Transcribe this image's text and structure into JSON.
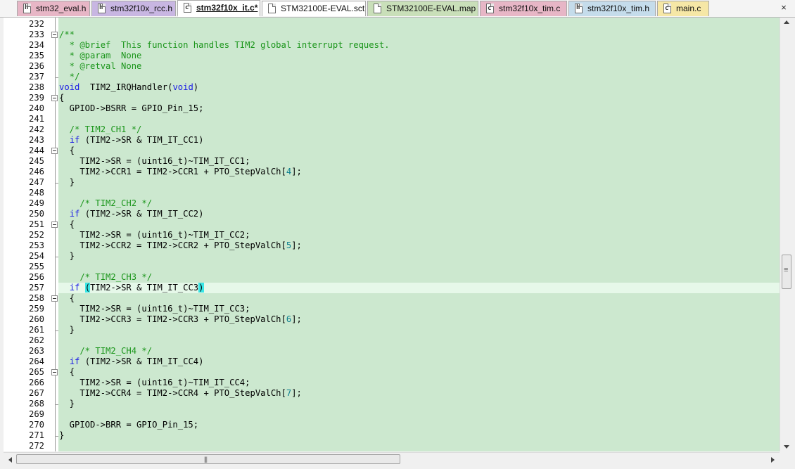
{
  "tabs": [
    {
      "label": "stm32_eval.h",
      "icon": "header-file-icon",
      "color": "#e7b6c6",
      "active": false
    },
    {
      "label": "stm32f10x_rcc.h",
      "icon": "header-file-icon",
      "color": "#c8b6e2",
      "active": false
    },
    {
      "label": "stm32f10x_it.c*",
      "icon": "source-file-icon",
      "color": "#ffffff",
      "active": true
    },
    {
      "label": "STM32100E-EVAL.sct",
      "icon": "file-icon",
      "color": "#ffffff",
      "active": false
    },
    {
      "label": "STM32100E-EVAL.map",
      "icon": "file-icon",
      "color": "#c9dfb9",
      "active": false
    },
    {
      "label": "stm32f10x_tim.c",
      "icon": "source-file-icon",
      "color": "#e7b6c6",
      "active": false
    },
    {
      "label": "stm32f10x_tim.h",
      "icon": "header-file-icon",
      "color": "#c5dceb",
      "active": false
    },
    {
      "label": "main.c",
      "icon": "source-file-icon",
      "color": "#f6e7a6",
      "active": false
    }
  ],
  "tabs_close": "×",
  "colors": {
    "editor_background": "#cce8cf",
    "current_line": "#e6f8e9",
    "keyword": "#1a1ae6",
    "comment": "#1a951a",
    "number": "#0b7f8f",
    "brace_match": "#39e6e6"
  },
  "editor": {
    "lines": [
      {
        "n": "232",
        "fold": "none",
        "parts": [
          {
            "t": "",
            "c": ""
          }
        ]
      },
      {
        "n": "233",
        "fold": "open",
        "parts": [
          {
            "t": "/**",
            "c": "cm"
          }
        ]
      },
      {
        "n": "234",
        "fold": "none",
        "parts": [
          {
            "t": "  * @brief  This function handles TIM2 global interrupt request.",
            "c": "cm"
          }
        ]
      },
      {
        "n": "235",
        "fold": "none",
        "parts": [
          {
            "t": "  * @param  None",
            "c": "cm"
          }
        ]
      },
      {
        "n": "236",
        "fold": "none",
        "parts": [
          {
            "t": "  * @retval None",
            "c": "cm"
          }
        ]
      },
      {
        "n": "237",
        "fold": "end",
        "parts": [
          {
            "t": "  */",
            "c": "cm"
          }
        ]
      },
      {
        "n": "238",
        "fold": "none",
        "parts": [
          {
            "t": "void",
            "c": "kw"
          },
          {
            "t": "  TIM2_IRQHandler(",
            "c": ""
          },
          {
            "t": "void",
            "c": "kw"
          },
          {
            "t": ")",
            "c": ""
          }
        ]
      },
      {
        "n": "239",
        "fold": "open",
        "parts": [
          {
            "t": "{",
            "c": ""
          }
        ]
      },
      {
        "n": "240",
        "fold": "none",
        "parts": [
          {
            "t": "  GPIOD->BSRR = GPIO_Pin_15;",
            "c": ""
          }
        ]
      },
      {
        "n": "241",
        "fold": "none",
        "parts": [
          {
            "t": "",
            "c": ""
          }
        ]
      },
      {
        "n": "242",
        "fold": "none",
        "parts": [
          {
            "t": "  /* TIM2_CH1 */",
            "c": "cm"
          }
        ]
      },
      {
        "n": "243",
        "fold": "none",
        "parts": [
          {
            "t": "  ",
            "c": ""
          },
          {
            "t": "if",
            "c": "kw"
          },
          {
            "t": " (TIM2->SR & TIM_IT_CC1)",
            "c": ""
          }
        ]
      },
      {
        "n": "244",
        "fold": "open",
        "parts": [
          {
            "t": "  {",
            "c": ""
          }
        ]
      },
      {
        "n": "245",
        "fold": "none",
        "parts": [
          {
            "t": "    TIM2->SR = (uint16_t)~TIM_IT_CC1;",
            "c": ""
          }
        ]
      },
      {
        "n": "246",
        "fold": "none",
        "parts": [
          {
            "t": "    TIM2->CCR1 = TIM2->CCR1 + PTO_StepValCh[",
            "c": ""
          },
          {
            "t": "4",
            "c": "num"
          },
          {
            "t": "];",
            "c": ""
          }
        ]
      },
      {
        "n": "247",
        "fold": "end",
        "parts": [
          {
            "t": "  }",
            "c": ""
          }
        ]
      },
      {
        "n": "248",
        "fold": "none",
        "parts": [
          {
            "t": "",
            "c": ""
          }
        ]
      },
      {
        "n": "249",
        "fold": "none",
        "parts": [
          {
            "t": "    /* TIM2_CH2 */",
            "c": "cm"
          }
        ]
      },
      {
        "n": "250",
        "fold": "none",
        "parts": [
          {
            "t": "  ",
            "c": ""
          },
          {
            "t": "if",
            "c": "kw"
          },
          {
            "t": " (TIM2->SR & TIM_IT_CC2)",
            "c": ""
          }
        ]
      },
      {
        "n": "251",
        "fold": "open",
        "parts": [
          {
            "t": "  {",
            "c": ""
          }
        ]
      },
      {
        "n": "252",
        "fold": "none",
        "parts": [
          {
            "t": "    TIM2->SR = (uint16_t)~TIM_IT_CC2;",
            "c": ""
          }
        ]
      },
      {
        "n": "253",
        "fold": "none",
        "parts": [
          {
            "t": "    TIM2->CCR2 = TIM2->CCR2 + PTO_StepValCh[",
            "c": ""
          },
          {
            "t": "5",
            "c": "num"
          },
          {
            "t": "];",
            "c": ""
          }
        ]
      },
      {
        "n": "254",
        "fold": "end",
        "parts": [
          {
            "t": "  }",
            "c": ""
          }
        ]
      },
      {
        "n": "255",
        "fold": "none",
        "parts": [
          {
            "t": "",
            "c": ""
          }
        ]
      },
      {
        "n": "256",
        "fold": "none",
        "parts": [
          {
            "t": "    /* TIM2_CH3 */",
            "c": "cm"
          }
        ]
      },
      {
        "n": "257",
        "fold": "none",
        "current": true,
        "parts": [
          {
            "t": "  ",
            "c": ""
          },
          {
            "t": "if",
            "c": "kw"
          },
          {
            "t": " ",
            "c": ""
          },
          {
            "t": "(",
            "c": "bm"
          },
          {
            "t": "TIM2->SR & TIM_IT_CC3",
            "c": ""
          },
          {
            "t": ")",
            "c": "bm"
          }
        ]
      },
      {
        "n": "258",
        "fold": "open",
        "parts": [
          {
            "t": "  {",
            "c": ""
          }
        ]
      },
      {
        "n": "259",
        "fold": "none",
        "parts": [
          {
            "t": "    TIM2->SR = (uint16_t)~TIM_IT_CC3;",
            "c": ""
          }
        ]
      },
      {
        "n": "260",
        "fold": "none",
        "parts": [
          {
            "t": "    TIM2->CCR3 = TIM2->CCR3 + PTO_StepValCh[",
            "c": ""
          },
          {
            "t": "6",
            "c": "num"
          },
          {
            "t": "];",
            "c": ""
          }
        ]
      },
      {
        "n": "261",
        "fold": "end",
        "parts": [
          {
            "t": "  }",
            "c": ""
          }
        ]
      },
      {
        "n": "262",
        "fold": "none",
        "parts": [
          {
            "t": "",
            "c": ""
          }
        ]
      },
      {
        "n": "263",
        "fold": "none",
        "parts": [
          {
            "t": "    /* TIM2_CH4 */",
            "c": "cm"
          }
        ]
      },
      {
        "n": "264",
        "fold": "none",
        "parts": [
          {
            "t": "  ",
            "c": ""
          },
          {
            "t": "if",
            "c": "kw"
          },
          {
            "t": " (TIM2->SR & TIM_IT_CC4)",
            "c": ""
          }
        ]
      },
      {
        "n": "265",
        "fold": "open",
        "parts": [
          {
            "t": "  {",
            "c": ""
          }
        ]
      },
      {
        "n": "266",
        "fold": "none",
        "parts": [
          {
            "t": "    TIM2->SR = (uint16_t)~TIM_IT_CC4;",
            "c": ""
          }
        ]
      },
      {
        "n": "267",
        "fold": "none",
        "parts": [
          {
            "t": "    TIM2->CCR4 = TIM2->CCR4 + PTO_StepValCh[",
            "c": ""
          },
          {
            "t": "7",
            "c": "num"
          },
          {
            "t": "];",
            "c": ""
          }
        ]
      },
      {
        "n": "268",
        "fold": "end",
        "parts": [
          {
            "t": "  }",
            "c": ""
          }
        ]
      },
      {
        "n": "269",
        "fold": "none",
        "parts": [
          {
            "t": "",
            "c": ""
          }
        ]
      },
      {
        "n": "270",
        "fold": "none",
        "parts": [
          {
            "t": "  GPIOD->BRR = GPIO_Pin_15;",
            "c": ""
          }
        ]
      },
      {
        "n": "271",
        "fold": "end",
        "parts": [
          {
            "t": "}",
            "c": ""
          }
        ]
      },
      {
        "n": "272",
        "fold": "none",
        "parts": [
          {
            "t": "",
            "c": ""
          }
        ]
      }
    ]
  },
  "scrollbars": {
    "vertical_position": 0.55,
    "horizontal_position": 0.0
  }
}
